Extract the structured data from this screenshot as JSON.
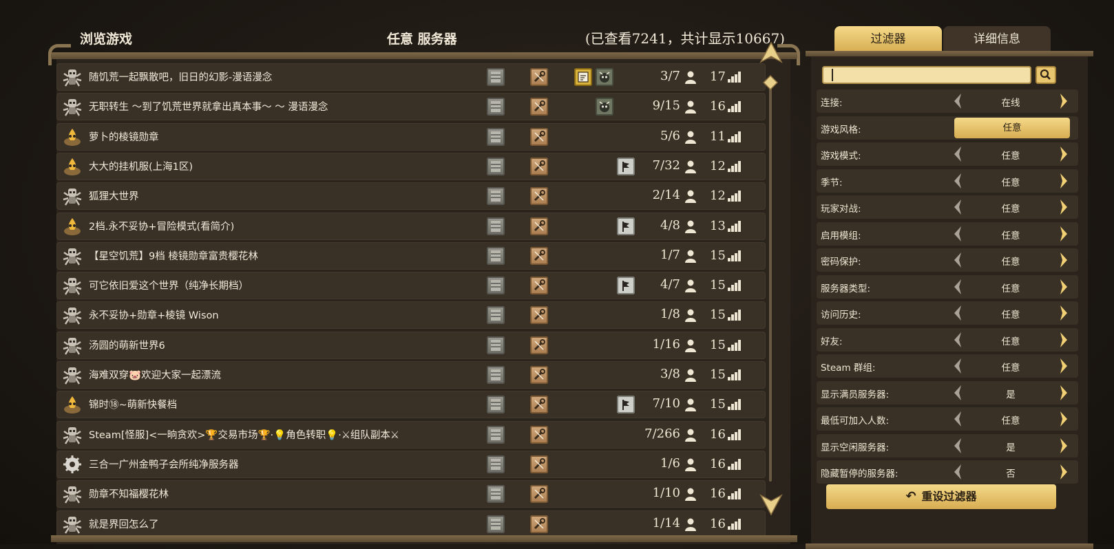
{
  "header": {
    "title": "浏览游戏",
    "center": "任意 服务器",
    "count": "(已查看7241，共计显示10667)"
  },
  "servers": [
    {
      "avatar": "spider-avatar",
      "name": "随饥荒一起飘散吧，旧日的幻影-漫语漫念",
      "icons": [
        "ex1",
        "ex2"
      ],
      "players": "3/7",
      "ping": "17"
    },
    {
      "avatar": "spider-avatar",
      "name": "无职转生 ～到了饥荒世界就拿出真本事～ ～ 漫语漫念",
      "icons": [
        "ex2"
      ],
      "players": "9/15",
      "ping": "16"
    },
    {
      "avatar": "flame-avatar",
      "name": "萝卜的棱镜勋章",
      "icons": [],
      "players": "5/6",
      "ping": "11"
    },
    {
      "avatar": "flame-avatar",
      "name": "大大的挂机服(上海1区)",
      "icons": [
        "ex3"
      ],
      "players": "7/32",
      "ping": "12"
    },
    {
      "avatar": "spider-avatar",
      "name": "狐狸大世界",
      "icons": [],
      "players": "2/14",
      "ping": "12"
    },
    {
      "avatar": "flame-avatar",
      "name": "2档.永不妥协+冒险模式(看简介)",
      "icons": [
        "ex3"
      ],
      "players": "4/8",
      "ping": "13"
    },
    {
      "avatar": "spider-avatar",
      "name": "【星空饥荒】9档 棱镜勋章富贵樱花林",
      "icons": [],
      "players": "1/7",
      "ping": "15"
    },
    {
      "avatar": "spider-avatar",
      "name": "可它依旧爱这个世界（纯净长期档）",
      "icons": [
        "ex3"
      ],
      "players": "4/7",
      "ping": "15"
    },
    {
      "avatar": "spider-avatar",
      "name": "永不妥协+勋章+棱镜 Wison",
      "icons": [],
      "players": "1/8",
      "ping": "15"
    },
    {
      "avatar": "spider-avatar",
      "name": "汤圆的萌新世界6",
      "icons": [],
      "players": "1/16",
      "ping": "15"
    },
    {
      "avatar": "spider-avatar",
      "name": "海难双穿🐷欢迎大家一起漂流",
      "icons": [],
      "players": "3/8",
      "ping": "15"
    },
    {
      "avatar": "flame-avatar",
      "name": "锦时⑱~萌新快餐档",
      "icons": [
        "ex3"
      ],
      "players": "7/10",
      "ping": "15"
    },
    {
      "avatar": "spider-avatar",
      "name": "Steam[怪服]<一晌贪欢>🏆交易市场🏆·💡角色转职💡·⚔组队副本⚔",
      "icons": [],
      "players": "7/266",
      "ping": "16"
    },
    {
      "avatar": "gear-avatar",
      "name": "三合一广州金鸭子会所纯净服务器",
      "icons": [],
      "players": "1/6",
      "ping": "16"
    },
    {
      "avatar": "spider-avatar",
      "name": "勋章不知福樱花林",
      "icons": [],
      "players": "1/10",
      "ping": "16"
    },
    {
      "avatar": "spider-avatar",
      "name": "就是界回怎么了",
      "icons": [],
      "players": "1/14",
      "ping": "16"
    }
  ],
  "tabs": {
    "filters": "过滤器",
    "details": "详细信息"
  },
  "search": {
    "value": ""
  },
  "filters": [
    {
      "label": "连接:",
      "value": "在线"
    },
    {
      "label": "游戏风格:",
      "value": "任意",
      "pill": true
    },
    {
      "label": "游戏模式:",
      "value": "任意"
    },
    {
      "label": "季节:",
      "value": "任意"
    },
    {
      "label": "玩家对战:",
      "value": "任意"
    },
    {
      "label": "启用模组:",
      "value": "任意"
    },
    {
      "label": "密码保护:",
      "value": "任意"
    },
    {
      "label": "服务器类型:",
      "value": "任意"
    },
    {
      "label": "访问历史:",
      "value": "任意"
    },
    {
      "label": "好友:",
      "value": "任意"
    },
    {
      "label": "Steam 群组:",
      "value": "任意"
    },
    {
      "label": "显示满员服务器:",
      "value": "是"
    },
    {
      "label": "最低可加入人数:",
      "value": "任意"
    },
    {
      "label": "显示空闲服务器:",
      "value": "是"
    },
    {
      "label": "隐藏暂停的服务器:",
      "value": "否"
    }
  ],
  "reset": {
    "label": "重设过滤器"
  }
}
